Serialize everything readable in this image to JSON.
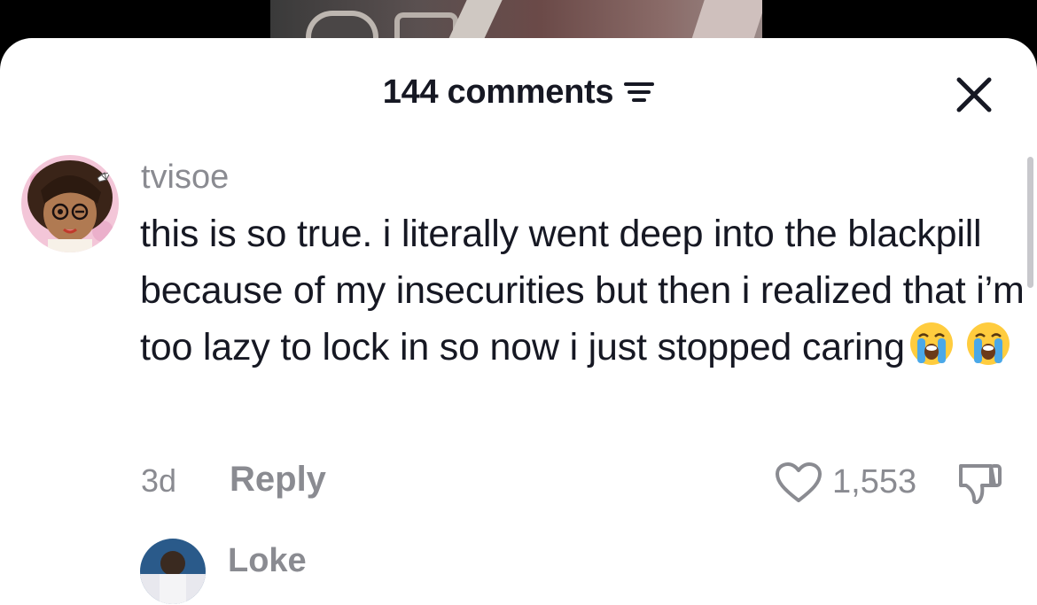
{
  "header": {
    "comment_count": "144 comments",
    "sort_icon": "sort-lines-icon",
    "close_icon": "close-x-icon"
  },
  "comments": [
    {
      "username": "tvisoe",
      "text": "this is so true. i literally went deep into the blackpill because of my insecurities but then i realized that i’m too lazy to lock in so now i just stopped caring",
      "emojis": [
        "loudly-crying-face",
        "loudly-crying-face"
      ],
      "time": "3d",
      "reply_label": "Reply",
      "like_count": "1,553",
      "like_icon": "heart-outline-icon",
      "dislike_icon": "thumbs-down-icon"
    },
    {
      "username": "Loke"
    }
  ],
  "colors": {
    "primary_text": "#161823",
    "secondary_text": "#8a8b91",
    "sheet_bg": "#ffffff",
    "backdrop": "#000000",
    "emoji_yellow": "#ffcc3e",
    "emoji_tears": "#4aa8e8"
  }
}
